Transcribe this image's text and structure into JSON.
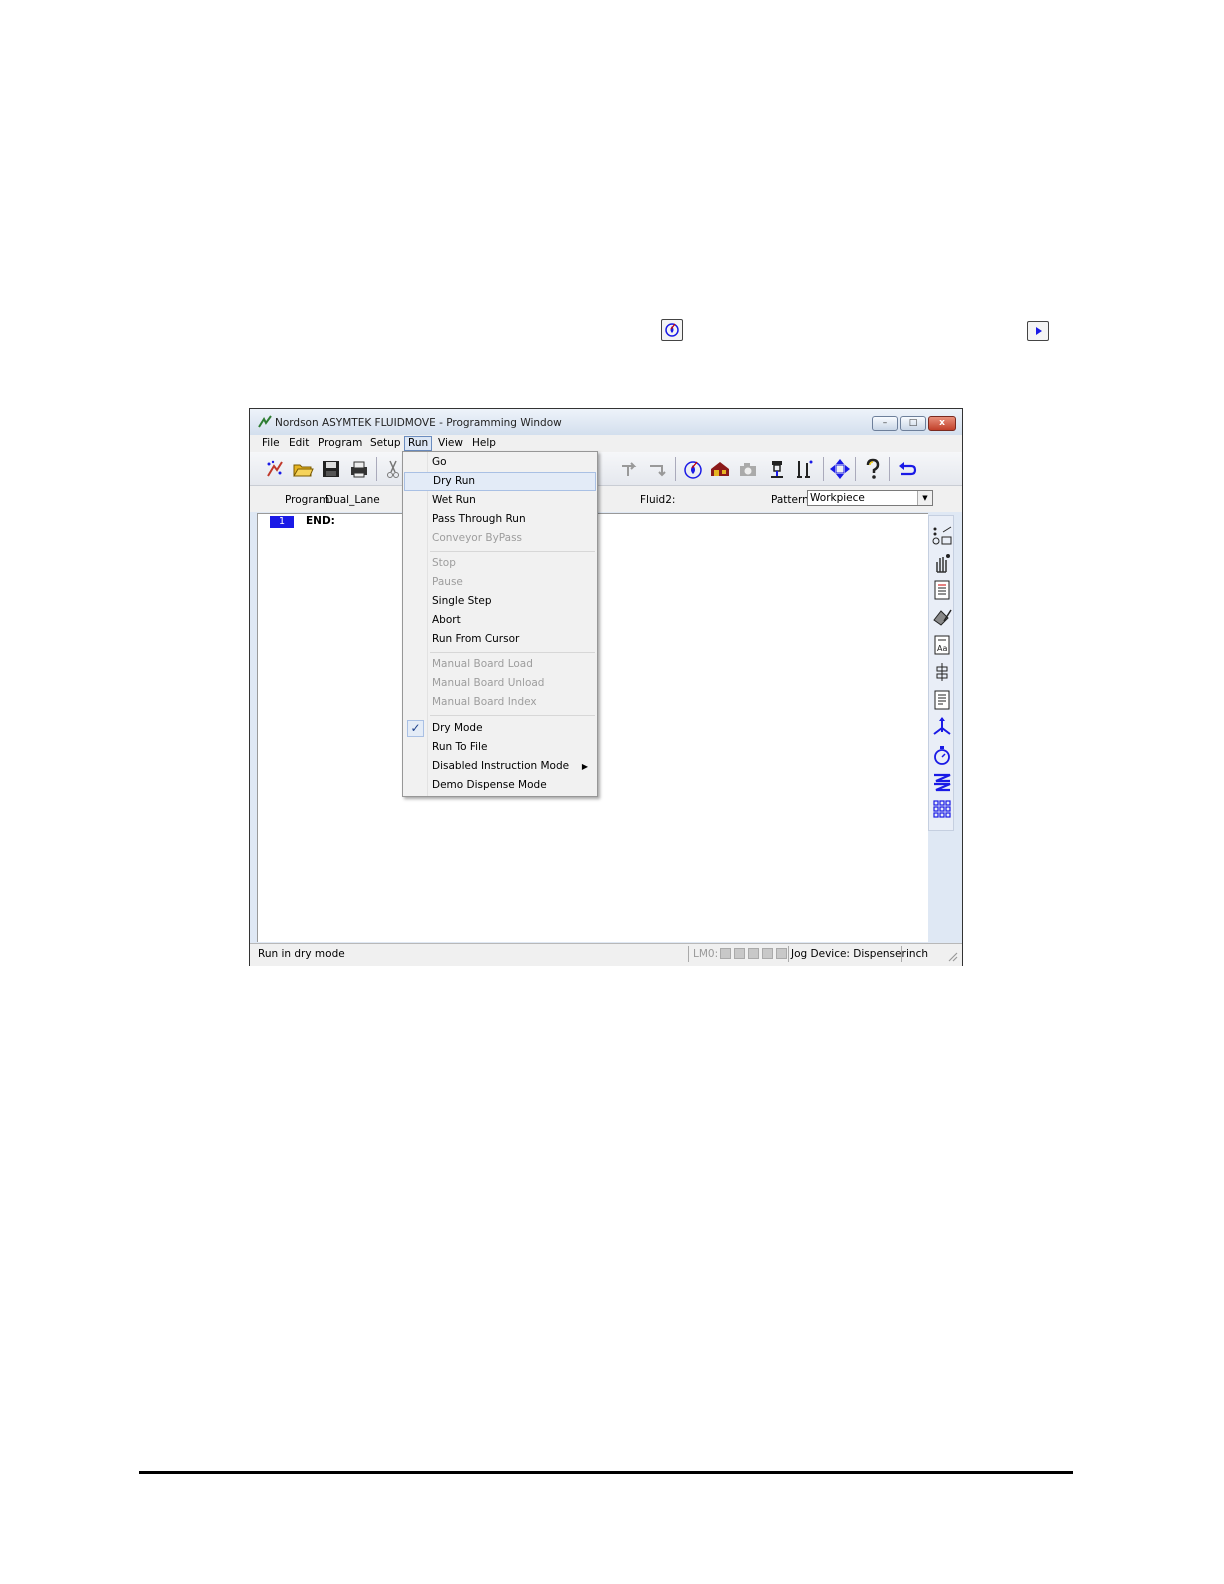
{
  "window": {
    "title": "Nordson ASYMTEK FLUIDMOVE - Programming Window",
    "buttons": {
      "minimize": "–",
      "maximize": "□",
      "close": "x"
    }
  },
  "menubar": [
    "File",
    "Edit",
    "Program",
    "Setup",
    "Run",
    "View",
    "Help"
  ],
  "infobar": {
    "program_label": "Program:",
    "program_value": "Dual_Lane",
    "fluid_label": "Fluid2:",
    "pattern_label": "Pattern",
    "pattern_value": "Workpiece"
  },
  "editor": {
    "line_number": "1",
    "line_text": "END:"
  },
  "run_menu": {
    "items": [
      {
        "label": "Go",
        "enabled": true
      },
      {
        "label": "Dry Run",
        "enabled": true,
        "highlighted": true
      },
      {
        "label": "Wet Run",
        "enabled": true
      },
      {
        "label": "Pass Through Run",
        "enabled": true
      },
      {
        "label": "Conveyor ByPass",
        "enabled": false
      },
      {
        "label": "Stop",
        "enabled": false
      },
      {
        "label": "Pause",
        "enabled": false
      },
      {
        "label": "Single Step",
        "enabled": true
      },
      {
        "label": "Abort",
        "enabled": true
      },
      {
        "label": "Run From Cursor",
        "enabled": true
      },
      {
        "label": "Manual Board Load",
        "enabled": false
      },
      {
        "label": "Manual Board Unload",
        "enabled": false
      },
      {
        "label": "Manual Board Index",
        "enabled": false
      },
      {
        "label": "Dry Mode",
        "enabled": true,
        "checked": true
      },
      {
        "label": "Run To File",
        "enabled": true
      },
      {
        "label": "Disabled Instruction Mode",
        "enabled": true,
        "submenu": true
      },
      {
        "label": "Demo Dispense Mode",
        "enabled": true
      }
    ],
    "check_glyph": "✓",
    "submenu_glyph": "▶"
  },
  "statusbar": {
    "message": "Run in dry mode",
    "lm_label": "LM0:",
    "jog_device": "Jog Device: Dispenser",
    "units": "inch"
  },
  "icons": {
    "toolbar": [
      "new-icon",
      "open-icon",
      "save-icon",
      "print-icon",
      "cut-icon",
      "step-over-icon",
      "step-back-icon",
      "purge-icon",
      "home-icon",
      "camera-icon",
      "dispenser-icon",
      "calibrate-icon",
      "jog-icon",
      "help-icon",
      "undo-icon"
    ],
    "sidebar": [
      "dot-line-icon",
      "hand-icon",
      "document-icon",
      "tools-icon",
      "report-icon",
      "align-icon",
      "list-icon",
      "move-icon",
      "timer-icon",
      "zz-icon",
      "grid-icon"
    ],
    "accent": "#1a1ae6"
  }
}
